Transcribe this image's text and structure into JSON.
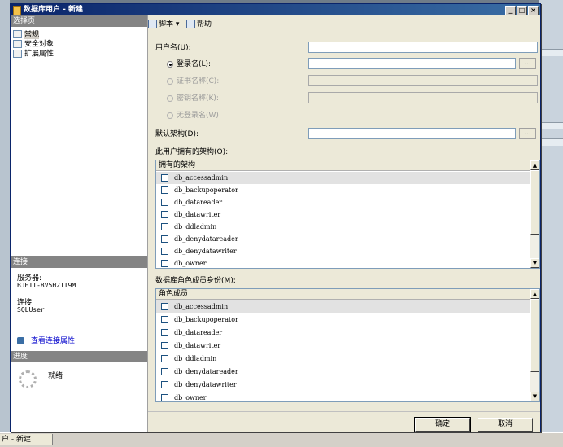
{
  "window": {
    "title": "数据库用户 - 新建"
  },
  "left_pane": {
    "select_page_header": "选择页",
    "pages": [
      {
        "label": "常规",
        "selected": true
      },
      {
        "label": "安全对象",
        "selected": false
      },
      {
        "label": "扩展属性",
        "selected": false
      }
    ],
    "connection_header": "连接",
    "server_label": "服务器:",
    "server_value": "BJHIT-8V5H2II9M",
    "connection_label": "连接:",
    "connection_value": "SQLUser",
    "view_connection_link": "查看连接属性",
    "progress_header": "进度",
    "progress_status": "就绪"
  },
  "toolbar": {
    "script_label": "脚本",
    "help_label": "帮助"
  },
  "form": {
    "username_label": "用户名(U):",
    "username_value": "",
    "login_radio_label": "登录名(L):",
    "login_value": "",
    "cert_radio_label": "证书名称(C):",
    "key_radio_label": "密钥名称(K):",
    "nologin_radio_label": "无登录名(W)",
    "default_schema_label": "默认架构(D):",
    "default_schema_value": "",
    "ellipsis": "...",
    "owned_schemas_label": "此用户拥有的架构(O):",
    "owned_schemas_header": "拥有的架构",
    "owned_schemas": [
      "db_accessadmin",
      "db_backupoperator",
      "db_datareader",
      "db_datawriter",
      "db_ddladmin",
      "db_denydatareader",
      "db_denydatawriter",
      "db_owner"
    ],
    "role_membership_label": "数据库角色成员身份(M):",
    "role_membership_header": "角色成员",
    "roles": [
      "db_accessadmin",
      "db_backupoperator",
      "db_datareader",
      "db_datawriter",
      "db_ddladmin",
      "db_denydatareader",
      "db_denydatawriter",
      "db_owner"
    ]
  },
  "buttons": {
    "ok": "确定",
    "cancel": "取消"
  },
  "taskbar": {
    "item": "户 - 新建"
  },
  "colors": {
    "title_bar": "#0a246a",
    "dialog_bg": "#ece9d8",
    "pane_header": "#848484",
    "link": "#0000cc"
  }
}
